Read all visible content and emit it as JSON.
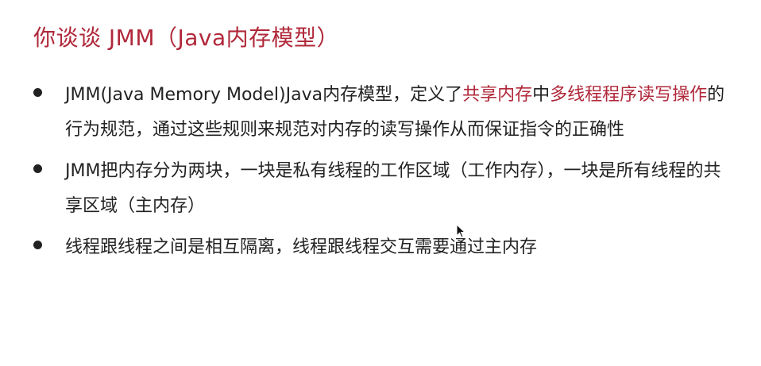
{
  "slide": {
    "title": "你谈谈 JMM（Java内存模型）",
    "bullets": [
      {
        "parts": [
          {
            "text": "JMM(Java Memory Model)Java内存模型，定义了",
            "highlight": false
          },
          {
            "text": "共享内存",
            "highlight": true
          },
          {
            "text": "中",
            "highlight": false
          },
          {
            "text": "多线程程序读写操作",
            "highlight": true
          },
          {
            "text": "的行为规范，通过这些规则来规范对内存的读写操作从而保证指令的正确性",
            "highlight": false
          }
        ]
      },
      {
        "parts": [
          {
            "text": "JMM把内存分为两块，一块是私有线程的工作区域（工作内存），一块是所有线程的共享区域（主内存）",
            "highlight": false
          }
        ]
      },
      {
        "parts": [
          {
            "text": "线程跟线程之间是相互隔离，线程跟线程交互需要通过主内存",
            "highlight": false
          }
        ]
      }
    ]
  },
  "colors": {
    "accent": "#b0283a",
    "text": "#222222",
    "background": "#ffffff"
  },
  "icons": {
    "cursor": "mouse-pointer-icon",
    "bullet": "bullet-dot-icon"
  }
}
